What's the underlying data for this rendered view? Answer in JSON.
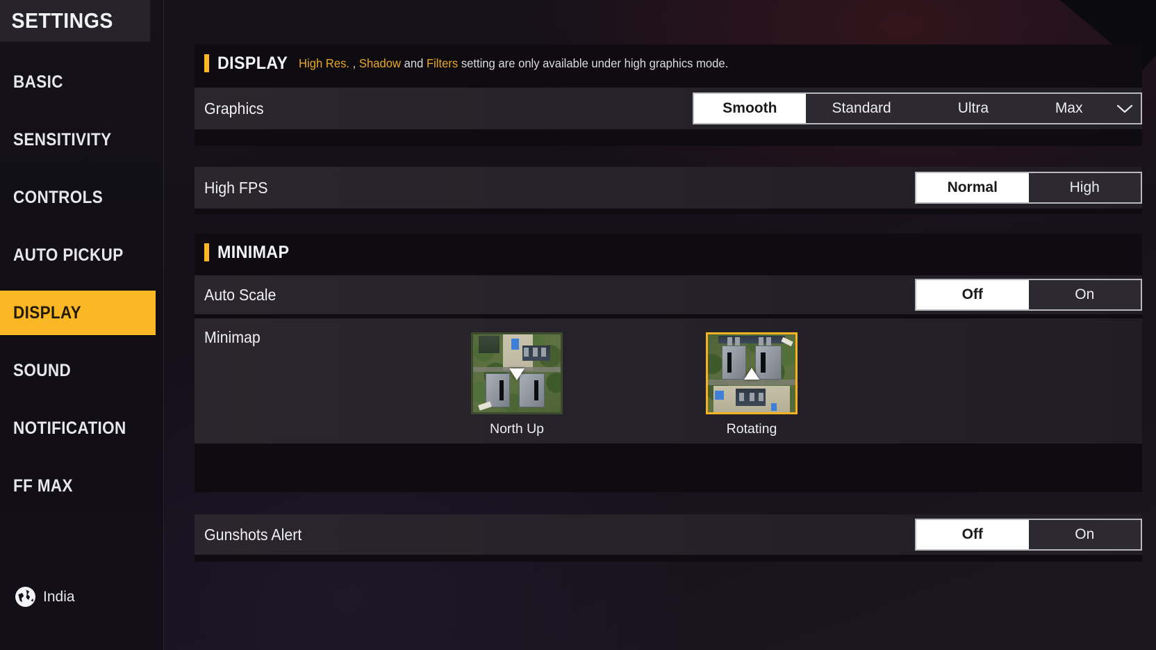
{
  "sidebar": {
    "title": "SETTINGS",
    "items": [
      {
        "label": "BASIC",
        "active": false
      },
      {
        "label": "SENSITIVITY",
        "active": false
      },
      {
        "label": "CONTROLS",
        "active": false
      },
      {
        "label": "AUTO PICKUP",
        "active": false
      },
      {
        "label": "DISPLAY",
        "active": true
      },
      {
        "label": "SOUND",
        "active": false
      },
      {
        "label": "NOTIFICATION",
        "active": false
      },
      {
        "label": "FF MAX",
        "active": false
      }
    ],
    "region": {
      "icon": "globe-icon",
      "label": "India"
    }
  },
  "display_section": {
    "title": "DISPLAY",
    "note_parts": [
      {
        "text": "High Res. ",
        "highlight": true
      },
      {
        "text": ", ",
        "highlight": false
      },
      {
        "text": "Shadow",
        "highlight": true
      },
      {
        "text": " and ",
        "highlight": false
      },
      {
        "text": "Filters",
        "highlight": true
      },
      {
        "text": " setting are only available under high graphics mode.",
        "highlight": false
      }
    ],
    "note_plain": "High Res. , Shadow and Filters setting are only available under high graphics mode."
  },
  "rows": {
    "graphics": {
      "label": "Graphics",
      "options": [
        "Smooth",
        "Standard",
        "Ultra",
        "Max"
      ],
      "selected": "Smooth",
      "chevron_icon": "chevron-down-icon"
    },
    "high_fps": {
      "label": "High FPS",
      "options": [
        "Normal",
        "High"
      ],
      "selected": "Normal"
    },
    "auto_scale": {
      "label": "Auto Scale",
      "options": [
        "Off",
        "On"
      ],
      "selected": "Off"
    },
    "minimap": {
      "label": "Minimap",
      "choices": [
        {
          "caption": "North Up",
          "selected": false
        },
        {
          "caption": "Rotating",
          "selected": true
        }
      ]
    },
    "gunshots_alert": {
      "label": "Gunshots Alert",
      "options": [
        "Off",
        "On"
      ],
      "selected": "Off"
    }
  },
  "minimap_section": {
    "title": "MINIMAP"
  },
  "colors": {
    "accent": "#fcb824",
    "accent_text": "#e8a825",
    "selected_bg": "#ffffff",
    "selected_text": "#1b1b1d",
    "row_bg": "#262229",
    "panel_bg": "#0f0c11",
    "sidebar_bg": "#141118",
    "text": "#f0f0f2"
  }
}
